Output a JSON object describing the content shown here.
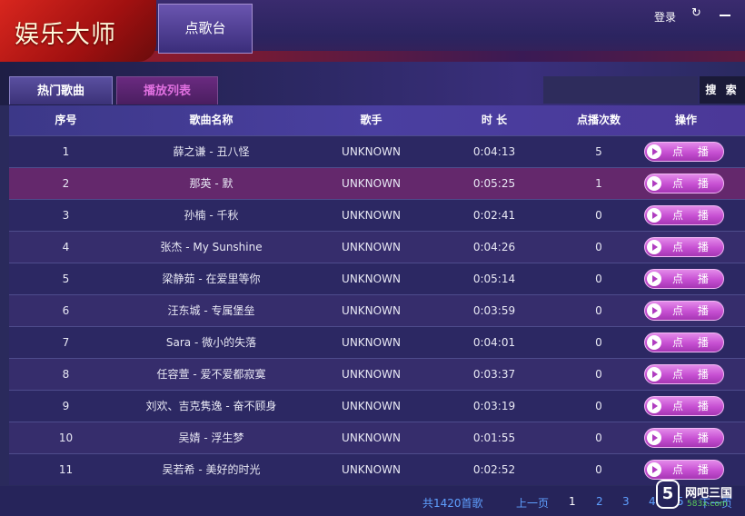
{
  "app": {
    "logo_text": "娱乐大师",
    "top_tab": "点歌台",
    "login": "登录"
  },
  "tabs": [
    {
      "label": "热门歌曲",
      "active": true
    },
    {
      "label": "播放列表",
      "active": false
    }
  ],
  "search": {
    "button_label": "搜 索",
    "value": ""
  },
  "table": {
    "headers": [
      "序号",
      "歌曲名称",
      "歌手",
      "时 长",
      "点播次数",
      "操作"
    ],
    "play_label": "点 播",
    "rows": [
      {
        "no": "1",
        "title": "薛之谦 - 丑八怪",
        "singer": "UNKNOWN",
        "duration": "0:04:13",
        "plays": "5"
      },
      {
        "no": "2",
        "title": "那英 - 默",
        "singer": "UNKNOWN",
        "duration": "0:05:25",
        "plays": "1"
      },
      {
        "no": "3",
        "title": "孙楠 - 千秋",
        "singer": "UNKNOWN",
        "duration": "0:02:41",
        "plays": "0"
      },
      {
        "no": "4",
        "title": "张杰 - My Sunshine",
        "singer": "UNKNOWN",
        "duration": "0:04:26",
        "plays": "0"
      },
      {
        "no": "5",
        "title": "梁静茹 - 在爱里等你",
        "singer": "UNKNOWN",
        "duration": "0:05:14",
        "plays": "0"
      },
      {
        "no": "6",
        "title": "汪东城 - 专属堡垒",
        "singer": "UNKNOWN",
        "duration": "0:03:59",
        "plays": "0"
      },
      {
        "no": "7",
        "title": "Sara - 微小的失落",
        "singer": "UNKNOWN",
        "duration": "0:04:01",
        "plays": "0"
      },
      {
        "no": "8",
        "title": "任容萱 - 爱不爱都寂寞",
        "singer": "UNKNOWN",
        "duration": "0:03:37",
        "plays": "0"
      },
      {
        "no": "9",
        "title": "刘欢、吉克隽逸 - 奋不顾身",
        "singer": "UNKNOWN",
        "duration": "0:03:19",
        "plays": "0"
      },
      {
        "no": "10",
        "title": "吴婧 - 浮生梦",
        "singer": "UNKNOWN",
        "duration": "0:01:55",
        "plays": "0"
      },
      {
        "no": "11",
        "title": "吴若希 - 美好的时光",
        "singer": "UNKNOWN",
        "duration": "0:02:52",
        "plays": "0"
      }
    ]
  },
  "pagination": {
    "total": "共1420首歌",
    "prev": "上一页",
    "pages": [
      "1",
      "2",
      "3",
      "4",
      "5"
    ],
    "current": "1",
    "next": "下一页"
  },
  "watermark": {
    "badge": "5",
    "name": "网吧三国",
    "sub": "583x.com"
  },
  "colors": {
    "accent": "#c64fd2",
    "brand_red": "#d8261e",
    "link": "#5fa0ff"
  }
}
